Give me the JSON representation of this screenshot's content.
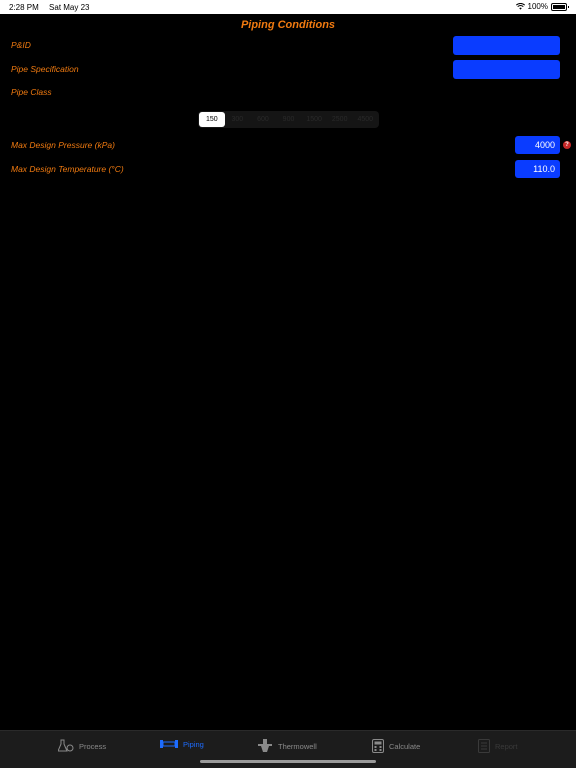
{
  "status_bar": {
    "time": "2:28 PM",
    "date": "Sat May 23",
    "battery": "100%"
  },
  "header": {
    "title": "Piping Conditions"
  },
  "form": {
    "pid_label": "P&ID",
    "pid_value": "",
    "pipe_spec_label": "Pipe Specification",
    "pipe_spec_value": "",
    "pipe_class_label": "Pipe Class",
    "pipe_class_options": [
      "150",
      "300",
      "600",
      "900",
      "1500",
      "2500",
      "4500"
    ],
    "pipe_class_selected": "150",
    "max_pressure_label": "Max Design Pressure (kPa)",
    "max_pressure_value": "4000",
    "max_temp_label": "Max Design Temperature (°C)",
    "max_temp_value": "110.0",
    "help_symbol": "?"
  },
  "tabs": [
    {
      "label": "Process",
      "icon": "flask-icon",
      "state": "normal"
    },
    {
      "label": "Piping",
      "icon": "pipe-icon",
      "state": "active"
    },
    {
      "label": "Thermowell",
      "icon": "thermowell-icon",
      "state": "normal"
    },
    {
      "label": "Calculate",
      "icon": "calculator-icon",
      "state": "normal"
    },
    {
      "label": "Report",
      "icon": "report-icon",
      "state": "disabled"
    }
  ],
  "colors": {
    "accent_orange": "#f07a10",
    "field_blue": "#0a3cff",
    "active_tab": "#1d6cff"
  }
}
